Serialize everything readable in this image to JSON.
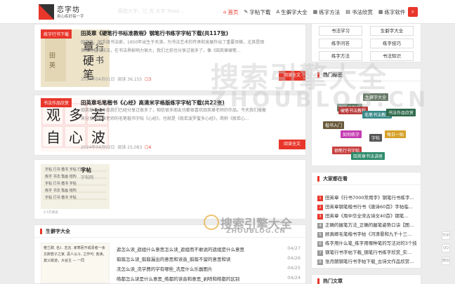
{
  "header": {
    "logo_title": "恋字坊",
    "logo_sub": "用心练好每一字",
    "faint_text": "蒋勋大字、江 苏 大字 Tosol...",
    "nav": [
      {
        "icon": "home-icon",
        "glyph": "⌂",
        "label": "首页",
        "active": true
      },
      {
        "icon": "pen-icon",
        "glyph": "✎",
        "label": "字帖下载",
        "active": false
      },
      {
        "icon": "font-icon",
        "glyph": "A",
        "label": "生僻字大全",
        "active": false
      },
      {
        "icon": "grid-icon",
        "glyph": "▦",
        "label": "练字方法",
        "active": false
      },
      {
        "icon": "book-icon",
        "glyph": "▤",
        "label": "书法欣赏",
        "active": false
      },
      {
        "icon": "apps-icon",
        "glyph": "▦",
        "label": "练字软件",
        "active": false
      }
    ],
    "search_glyph": "⌕"
  },
  "posts": [
    {
      "tag": "练字行书下载",
      "title": "田英章《硬笔行书标准教程》钢笔行书练字字帖下载(共117张)",
      "excerpt": "田英章，国手级书法家，1950年出生于天津。为书法艺术的传承和发展作出了重要贡献，尤其是田英章的楷书技法，在书法界影响力很大，我们之前也分享过很多了，像《田英章硬笔...",
      "date": "2024年04月01日",
      "views": "阅读 36,155",
      "comments": "3",
      "read": "阅读全文"
    },
    {
      "tag": "书法作品欣赏",
      "title": "田英章毛笔楷书《心经》高清米字格版练字字帖下载(共22张)",
      "excerpt": "田英章书法作品我们已经分享过很多了，相信很多朋友也都很喜欢田英章老师的作品。今天我们搜着来分享田英章老师的毛笔楷书字帖《心经》，也就是《般若波罗蜜多心经》，简称《般若心...",
      "date": "2024年04月02日",
      "views": "阅读 25,083",
      "comments": "4",
      "read": "阅读全文"
    },
    {
      "title": "字帖",
      "excerpt": "字帖网",
      "thumb_caption": "2.5万阅读"
    }
  ],
  "sidebar": {
    "categories": [
      "书法学习",
      "生僻字大全",
      "练字问答",
      "练字技巧",
      "练字方法",
      "书法知识"
    ],
    "tags_title": "热门标签",
    "tags": [
      {
        "label": "生僻字大全",
        "color": "#6a7b6a"
      },
      {
        "label": "田英章楷书",
        "color": "#5e7d6a"
      },
      {
        "label": "硬笔书法教程",
        "color": "#b83b3b"
      },
      {
        "label": "毛笔书法教程",
        "color": "#3a8a8a"
      },
      {
        "label": "书法作品欣赏",
        "color": "#2e6a4a"
      },
      {
        "label": "楷书入门",
        "color": "#6a5a3a"
      },
      {
        "label": "如何练字",
        "color": "#c43cb0"
      },
      {
        "label": "字帖",
        "color": "#555555"
      },
      {
        "label": "每日一贴",
        "color": "#d6a22a"
      },
      {
        "label": "钢笔行书字帖",
        "color": "#c84040"
      },
      {
        "label": "田英章书法讲座",
        "color": "#2e8a6a"
      }
    ],
    "hot_title": "大家都在看",
    "hot": [
      {
        "n": "1",
        "text": "田英章《行书7000常用字》钢笔行书练字...",
        "color": "#e8362b"
      },
      {
        "n": "2",
        "text": "田英章钢笔楷书行书《唐诗60首》字帖临...",
        "color": "#e8362b"
      },
      {
        "n": "3",
        "text": "田英章《周中华全宋古诗文40首》钢笔...",
        "color": "#e8362b"
      },
      {
        "n": "4",
        "text": "正确的握笔方法_正确的握笔姿势口诀【图...",
        "color": "#999999"
      },
      {
        "n": "5",
        "text": "顾真卿毛笔楷书字帖《河清晏和九千十三...",
        "color": "#999999"
      },
      {
        "n": "6",
        "text": "练字用什么笔_练字用哪种笔的写法对的3个技...",
        "color": "#999999"
      },
      {
        "n": "7",
        "text": "钢笔行书字帖下载_钢笔行书练字欣赏_实...",
        "color": "#999999"
      },
      {
        "n": "8",
        "text": "张月朗钢笔行书字帖下载_古诗文作品欣赏...",
        "color": "#999999"
      }
    ],
    "bottom_title": "热门文章"
  },
  "dict": {
    "title": "生僻字大全",
    "items": [
      {
        "text": "遮怎么读_遮组什么意思怎么读_遮组而不敢说的遮组是什么意思",
        "date": "04/27"
      },
      {
        "text": "翦翦怎么读_翦翦漏出的意思和读音_翦翦不留的意思和读",
        "date": "04/26"
      },
      {
        "text": "冼怎么读_冼学费的学有哪些_冼是什么乐器图片",
        "date": "04/25"
      },
      {
        "text": "皓都怎么读是什么意思_皓都的读音和意思_剥喷和皓都的区别",
        "date": "04/24"
      }
    ],
    "thumb_text": "卷兰辞, 名1, 志言, 家寒而不戒贵者一余文辞若子之家, 恶人以斗, 之作可, 各读，其父故道，大谷主 — 一同"
  },
  "watermark": {
    "big": "搜索引擎大全",
    "site": "ZHOUBLOG.CN"
  },
  "right_tools": [
    "TOP",
    "QQ",
    "微信"
  ]
}
